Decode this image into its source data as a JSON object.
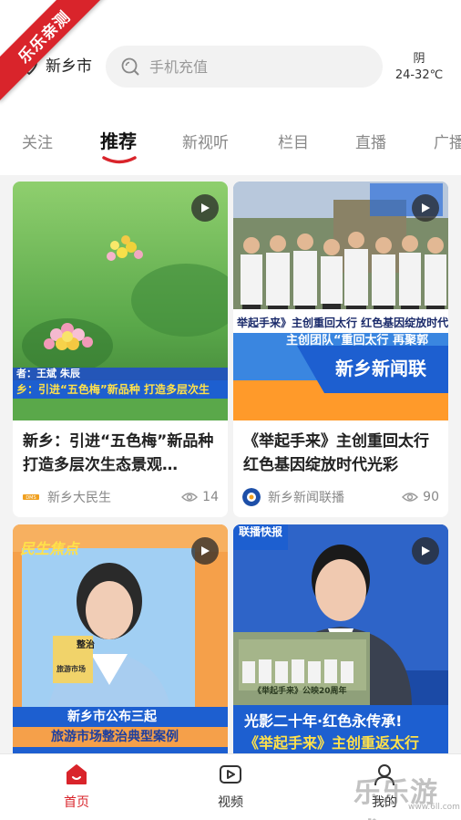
{
  "corner_badge": "乐乐亲测",
  "header": {
    "location": "新乡市",
    "search_placeholder": "手机充值",
    "weather_condition": "阴",
    "weather_temp": "24-32℃"
  },
  "tabs": [
    "关注",
    "推荐",
    "新视听",
    "栏目",
    "直播",
    "广播"
  ],
  "active_tab": "推荐",
  "cards": [
    {
      "title": "新乡：引进“五色梅”新品种 打造多层次生态景观…",
      "source": "新乡大民生",
      "views": "14",
      "thumb_caption_top": "者：王斌 朱辰",
      "thumb_caption": "乡：引进“五色梅”新品种 打造多层次生"
    },
    {
      "title": "《举起手来》主创重回太行 红色基因绽放时代光彩",
      "source": "新乡新闻联播",
      "views": "90",
      "thumb_caption": "举起手来》主创重回太行 红色基因绽放时代光彩",
      "thumb_sub": "主创团队“重回太行 再聚郭",
      "thumb_brand": "新乡新闻联"
    },
    {
      "thumb_badge": "民生焦点",
      "thumb_small_sign": "整治",
      "thumb_sign": "旅游市场",
      "thumb_line1": "新乡市公布三起",
      "thumb_line2": "旅游市场整治典型案例"
    },
    {
      "thumb_badge": "联播快报",
      "thumb_banner": "《举起手来》公映20周年",
      "thumb_line1": "光影二十年·红色永传承!",
      "thumb_line2": "《举起手来》主创重返太行"
    }
  ],
  "bottom_nav": [
    {
      "label": "首页",
      "icon": "home-icon"
    },
    {
      "label": "视频",
      "icon": "video-icon"
    },
    {
      "label": "我的",
      "icon": "profile-icon"
    }
  ],
  "watermark": "乐乐游戏",
  "watermark_url": "www.6ll.com",
  "colors": {
    "accent": "#d9242b",
    "news_blue": "#1d5fd0"
  }
}
